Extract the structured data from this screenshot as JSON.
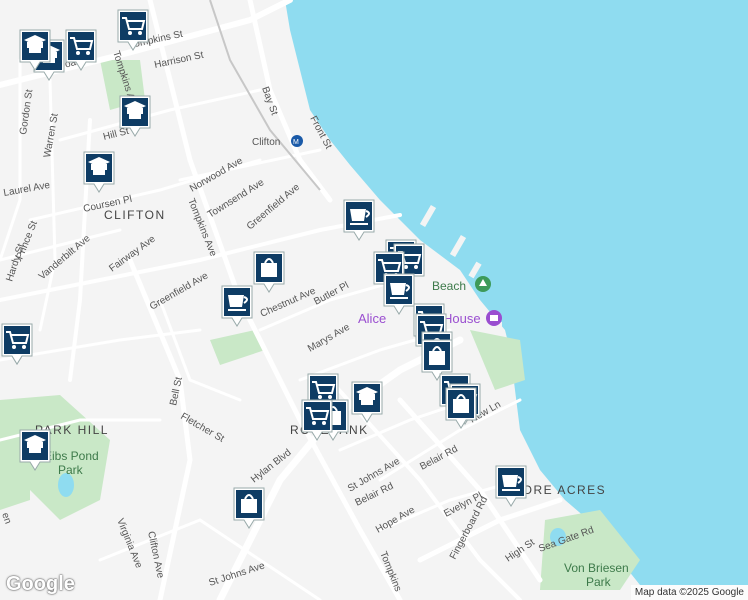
{
  "colors": {
    "water": "#8fdcf0",
    "land": "#f4f4f4",
    "park": "#c9e8c7",
    "road": "#ffffff",
    "marker": "#0e3c64"
  },
  "labels": {
    "neighborhoods": {
      "clifton": "CLIFTON",
      "park_hill": "PARK HILL",
      "rosebank": "ROSEBANK",
      "shore_acres": "SHORE ACRES"
    },
    "parks": {
      "eibs_pond_1": "Eibs Pond",
      "eibs_pond_2": "Park",
      "von_briesen_1": "Von Briesen",
      "von_briesen_2": "Park"
    },
    "poi": {
      "beach": "Beach",
      "house_prefix": "Alice",
      "house_suffix": "House"
    },
    "station": "Clifton",
    "streets": {
      "broad": "Broad St",
      "tompkins_st": "Tompkins St",
      "harrison": "Harrison St",
      "bay": "Bay St",
      "front": "Front St",
      "gordon": "Gordon St",
      "warren": "Warren St",
      "hill": "Hill St",
      "tompkins_ave_n": "Tompkins Ave",
      "norwood": "Norwood Ave",
      "townsend": "Townsend Ave",
      "greenfield_n": "Greenfield Ave",
      "coursen": "Coursen Pl",
      "laurel": "Laurel Ave",
      "prince": "Prince St",
      "hardy": "Hardy St",
      "vanderbilt": "Vanderbilt Ave",
      "fairway": "Fairway Ave",
      "greenfield_w": "Greenfield Ave",
      "tompkins_ave": "Tompkins Ave",
      "chestnut": "Chestnut Ave",
      "butler": "Butler Pl",
      "marys": "Marys Ave",
      "bell": "Bell St",
      "fletcher": "Fletcher St",
      "hylan": "Hylan Blvd",
      "st_johns_1": "St Johns Ave",
      "belair_1": "Belair Rd",
      "belair_2": "Belair Rd",
      "new_ln": "New Ln",
      "hope": "Hope Ave",
      "evelyn": "Evelyn Pl",
      "fingerboard": "Fingerboard Rd",
      "high": "High St",
      "sea_gate": "Sea Gate Rd",
      "virginia": "Virginia Ave",
      "clifton_ave": "Clifton Ave",
      "st_johns_2": "St Johns Ave",
      "tompkins_s": "Tompkins",
      "ls": "ls",
      "en": "en",
      "er": "er"
    }
  },
  "markers": [
    {
      "type": "school",
      "name": "school-marker"
    },
    {
      "type": "shopping",
      "name": "shopping-marker"
    },
    {
      "type": "shopping",
      "name": "shopping-marker"
    },
    {
      "type": "school",
      "name": "school-marker"
    },
    {
      "type": "school",
      "name": "school-marker"
    },
    {
      "type": "cafe",
      "name": "cafe-marker"
    },
    {
      "type": "shopping",
      "name": "shopping-marker"
    },
    {
      "type": "shopping",
      "name": "shopping-marker"
    },
    {
      "type": "cafe",
      "name": "cafe-marker"
    },
    {
      "type": "shopping",
      "name": "shopping-marker"
    },
    {
      "type": "bag",
      "name": "bag-marker"
    },
    {
      "type": "cafe",
      "name": "cafe-marker"
    },
    {
      "type": "shopping",
      "name": "shopping-marker"
    },
    {
      "type": "shopping",
      "name": "shopping-marker"
    },
    {
      "type": "bag",
      "name": "bag-marker"
    },
    {
      "type": "bag",
      "name": "bag-marker"
    },
    {
      "type": "shopping",
      "name": "shopping-marker"
    },
    {
      "type": "shopping",
      "name": "shopping-marker"
    },
    {
      "type": "shopping",
      "name": "shopping-marker"
    },
    {
      "type": "bag",
      "name": "bag-marker"
    },
    {
      "type": "bag",
      "name": "bag-marker"
    },
    {
      "type": "school",
      "name": "school-marker"
    },
    {
      "type": "shopping",
      "name": "shopping-marker"
    },
    {
      "type": "shopping",
      "name": "shopping-marker"
    },
    {
      "type": "school",
      "name": "school-marker"
    },
    {
      "type": "bag",
      "name": "bag-marker"
    },
    {
      "type": "cafe",
      "name": "cafe-marker"
    },
    {
      "type": "school",
      "name": "school-marker"
    },
    {
      "type": "shopping",
      "name": "shopping-marker"
    }
  ],
  "logo": "Google",
  "attribution": "Map data ©2025 Google"
}
